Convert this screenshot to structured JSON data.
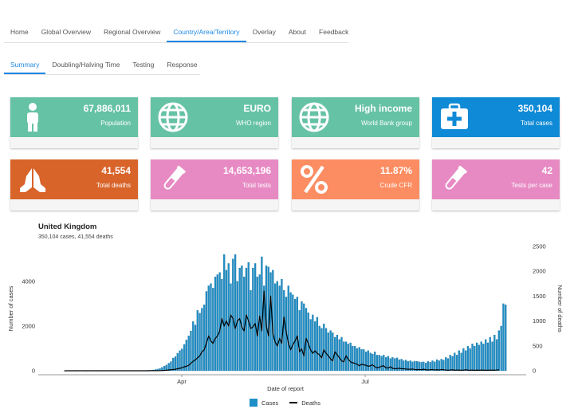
{
  "nav": {
    "tabs": [
      "Home",
      "Global Overview",
      "Regional Overview",
      "Country/Area/Territory",
      "Overlay",
      "About",
      "Feedback"
    ],
    "active": 3
  },
  "subnav": {
    "tabs": [
      "Summary",
      "Doubling/Halving Time",
      "Testing",
      "Response"
    ],
    "active": 0
  },
  "cards": [
    {
      "value": "67,886,011",
      "label": "Population",
      "color": "#66c2a5",
      "icon": "person-icon"
    },
    {
      "value": "EURO",
      "label": "WHO region",
      "color": "#66c2a5",
      "icon": "globe-icon"
    },
    {
      "value": "High income",
      "label": "World Bank group",
      "color": "#66c2a5",
      "icon": "globe-icon"
    },
    {
      "value": "350,104",
      "label": "Total cases",
      "color": "#0f8ad6",
      "icon": "medkit-icon"
    },
    {
      "value": "41,554",
      "label": "Total deaths",
      "color": "#d8642a",
      "icon": "praying-hands-icon"
    },
    {
      "value": "14,653,196",
      "label": "Total tests",
      "color": "#e78ac3",
      "icon": "test-tube-icon"
    },
    {
      "value": "11.87%",
      "label": "Crude CFR",
      "color": "#fc8d62",
      "icon": "percent-icon"
    },
    {
      "value": "42",
      "label": "Tests per case",
      "color": "#e78ac3",
      "icon": "test-tube-icon"
    }
  ],
  "chart": {
    "title": "United Kingdom",
    "subtitle": "350,104 cases, 41,554 deaths"
  },
  "chart_data": {
    "type": "bar",
    "xlabel": "Date of report",
    "ylabel": "Number of cases",
    "y2label": "Number of deaths",
    "x_ticks": [
      "Apr",
      "Jul"
    ],
    "y_ticks": [
      0,
      2000,
      4000
    ],
    "y2_ticks": [
      0,
      500,
      1000,
      1500,
      2000,
      2500
    ],
    "ylim": [
      0,
      5600
    ],
    "y2lim": [
      0,
      2500
    ],
    "start_date": "2020-01-31",
    "series": [
      {
        "name": "Cases",
        "type": "bar",
        "color": "#1f8fc8",
        "values": [
          2,
          0,
          0,
          0,
          0,
          1,
          0,
          0,
          0,
          0,
          1,
          0,
          0,
          0,
          0,
          1,
          0,
          0,
          0,
          0,
          0,
          0,
          0,
          0,
          0,
          0,
          1,
          0,
          0,
          3,
          9,
          12,
          7,
          4,
          4,
          5,
          10,
          15,
          20,
          25,
          35,
          55,
          75,
          105,
          150,
          210,
          260,
          340,
          410,
          570,
          630,
          780,
          900,
          980,
          1180,
          1380,
          1560,
          1780,
          2200,
          2050,
          2700,
          2580,
          2800,
          2950,
          3550,
          3800,
          3900,
          3700,
          4200,
          4300,
          4400,
          4100,
          5200,
          4500,
          4800,
          3900,
          5000,
          5200,
          4000,
          4600,
          4700,
          4200,
          4600,
          4850,
          3600,
          4600,
          4800,
          4200,
          4300,
          5100,
          3800,
          4700,
          4650,
          4400,
          4500,
          3900,
          4000,
          3800,
          4100,
          3600,
          3300,
          3800,
          3500,
          3400,
          3200,
          3300,
          2700,
          3100,
          3000,
          2800,
          2600,
          2300,
          2500,
          2200,
          2400,
          2000,
          1900,
          2100,
          1900,
          1700,
          1800,
          1700,
          1500,
          1600,
          1400,
          1500,
          1300,
          1300,
          1200,
          1250,
          1100,
          1100,
          1000,
          1050,
          950,
          950,
          850,
          900,
          800,
          750,
          850,
          700,
          700,
          650,
          700,
          600,
          650,
          550,
          600,
          550,
          580,
          500,
          520,
          450,
          480,
          420,
          450,
          400,
          430,
          420,
          400,
          380,
          400,
          350,
          420,
          380,
          450,
          400,
          500,
          450,
          520,
          480,
          600,
          550,
          700,
          650,
          800,
          700,
          900,
          800,
          1000,
          900,
          1100,
          1000,
          1200,
          1100,
          1250,
          1150,
          1300,
          1200,
          1400,
          1250,
          1500,
          1300,
          1600,
          1400,
          1800,
          2000,
          3000,
          2950
        ]
      },
      {
        "name": "Deaths",
        "type": "line",
        "color": "#000000",
        "axis": "right",
        "values": [
          0,
          0,
          0,
          0,
          0,
          0,
          0,
          0,
          0,
          0,
          0,
          0,
          0,
          0,
          0,
          0,
          0,
          0,
          0,
          0,
          0,
          0,
          0,
          0,
          0,
          0,
          0,
          0,
          0,
          0,
          0,
          0,
          0,
          0,
          0,
          0,
          0,
          1,
          0,
          1,
          1,
          2,
          1,
          3,
          4,
          7,
          10,
          16,
          20,
          25,
          30,
          40,
          50,
          60,
          80,
          90,
          110,
          150,
          190,
          220,
          260,
          300,
          380,
          420,
          560,
          700,
          600,
          550,
          650,
          700,
          800,
          1050,
          900,
          1000,
          900,
          1120,
          1050,
          850,
          1000,
          1050,
          880,
          800,
          1120,
          1000,
          850,
          880,
          950,
          700,
          1100,
          800,
          1600,
          900,
          700,
          1500,
          760,
          580,
          500,
          650,
          550,
          1080,
          780,
          550,
          420,
          520,
          600,
          700,
          380,
          440,
          300,
          650,
          540,
          420,
          350,
          400,
          350,
          320,
          260,
          420,
          350,
          300,
          240,
          200,
          380,
          320,
          260,
          200,
          180,
          300,
          230,
          180,
          160,
          150,
          130,
          100,
          130,
          120,
          110,
          90,
          100,
          120,
          80,
          60,
          70,
          90,
          100,
          60,
          55,
          80,
          50,
          40,
          45,
          50,
          40,
          40,
          35,
          30,
          30,
          35,
          25,
          20,
          25,
          20,
          30,
          20,
          15,
          20,
          25,
          15,
          20,
          15,
          25,
          20,
          15,
          10,
          15,
          20,
          10,
          15,
          12,
          10,
          12,
          20,
          12,
          10,
          14,
          8,
          12,
          10,
          14,
          10,
          12,
          8,
          14,
          10,
          12,
          15,
          20
        ]
      }
    ],
    "legend": "bottom"
  }
}
